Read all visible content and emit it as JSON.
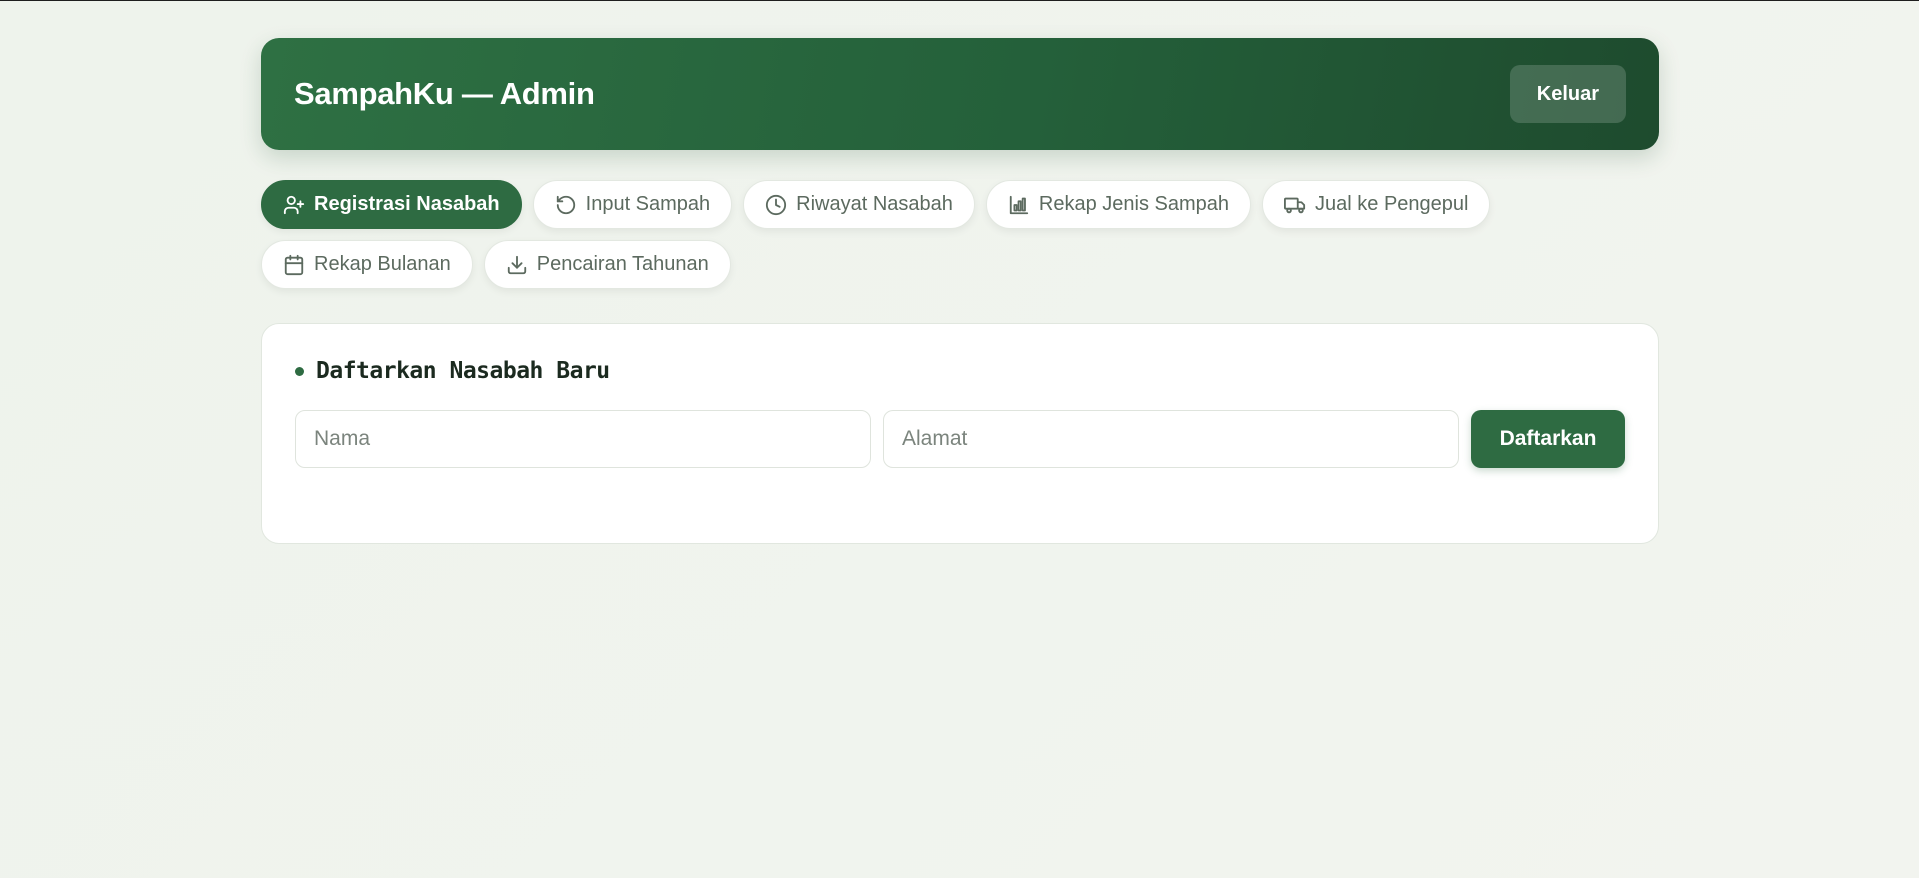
{
  "header": {
    "title": "SampahKu — Admin",
    "logout_label": "Keluar"
  },
  "tabs": [
    {
      "label": "Registrasi Nasabah",
      "icon": "user-plus-icon",
      "active": true
    },
    {
      "label": "Input Sampah",
      "icon": "rotate-ccw-icon",
      "active": false
    },
    {
      "label": "Riwayat Nasabah",
      "icon": "clock-icon",
      "active": false
    },
    {
      "label": "Rekap Jenis Sampah",
      "icon": "bar-chart-icon",
      "active": false
    },
    {
      "label": "Jual ke Pengepul",
      "icon": "truck-icon",
      "active": false
    },
    {
      "label": "Rekap Bulanan",
      "icon": "calendar-icon",
      "active": false
    },
    {
      "label": "Pencairan Tahunan",
      "icon": "download-icon",
      "active": false
    }
  ],
  "form": {
    "title": "Daftarkan Nasabah Baru",
    "name_placeholder": "Nama",
    "name_value": "",
    "address_placeholder": "Alamat",
    "address_value": "",
    "submit_label": "Daftarkan"
  },
  "colors": {
    "primary": "#2e6b42",
    "header_gradient_start": "#2e7043",
    "header_gradient_end": "#1e4b2e",
    "background": "#eef3ec"
  }
}
